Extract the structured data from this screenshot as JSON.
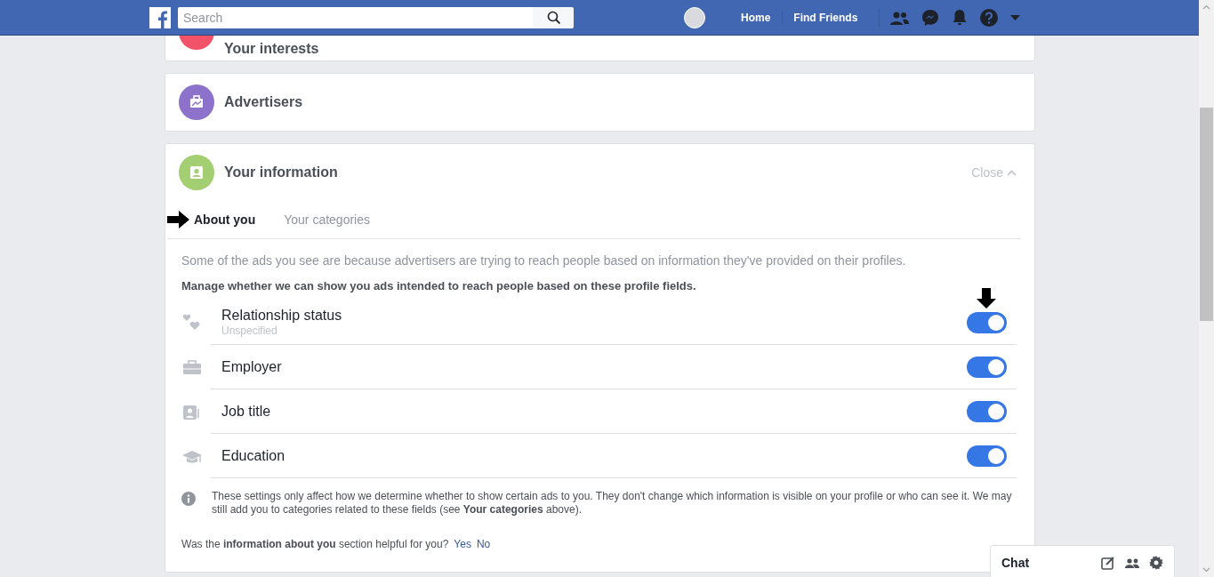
{
  "top_bar": {
    "search": {
      "placeholder": "Search"
    },
    "nav_links": [
      "Home",
      "Find Friends"
    ]
  },
  "sections": [
    {
      "title": "Your interests",
      "color": "#f35369"
    },
    {
      "title": "Advertisers",
      "color": "#8c72cb"
    },
    {
      "title": "Your information",
      "color": "#a3ce71",
      "close_label": "Close"
    }
  ],
  "tabs": [
    {
      "label": "About you",
      "selected": true
    },
    {
      "label": "Your categories",
      "selected": false
    }
  ],
  "description": "Some of the ads you see are because advertisers are trying to reach people based on information they've provided on their profiles.",
  "manage_heading": "Manage whether we can show you ads intended to reach people based on these profile fields.",
  "fields": [
    {
      "label": "Relationship status",
      "value": "Unspecified",
      "on": true
    },
    {
      "label": "Employer",
      "on": true
    },
    {
      "label": "Job title",
      "on": true
    },
    {
      "label": "Education",
      "on": true
    }
  ],
  "note": "These settings only affect how we determine whether to show certain ads to you. They don't change which information is visible on your profile or who can see it. We may still add you to categories related to these fields (see **Your categories** above).",
  "feedback": {
    "question": "Was the **information about you** section helpful for you?",
    "answers": [
      "Yes",
      "No"
    ]
  },
  "chat": {
    "title": "Chat"
  }
}
